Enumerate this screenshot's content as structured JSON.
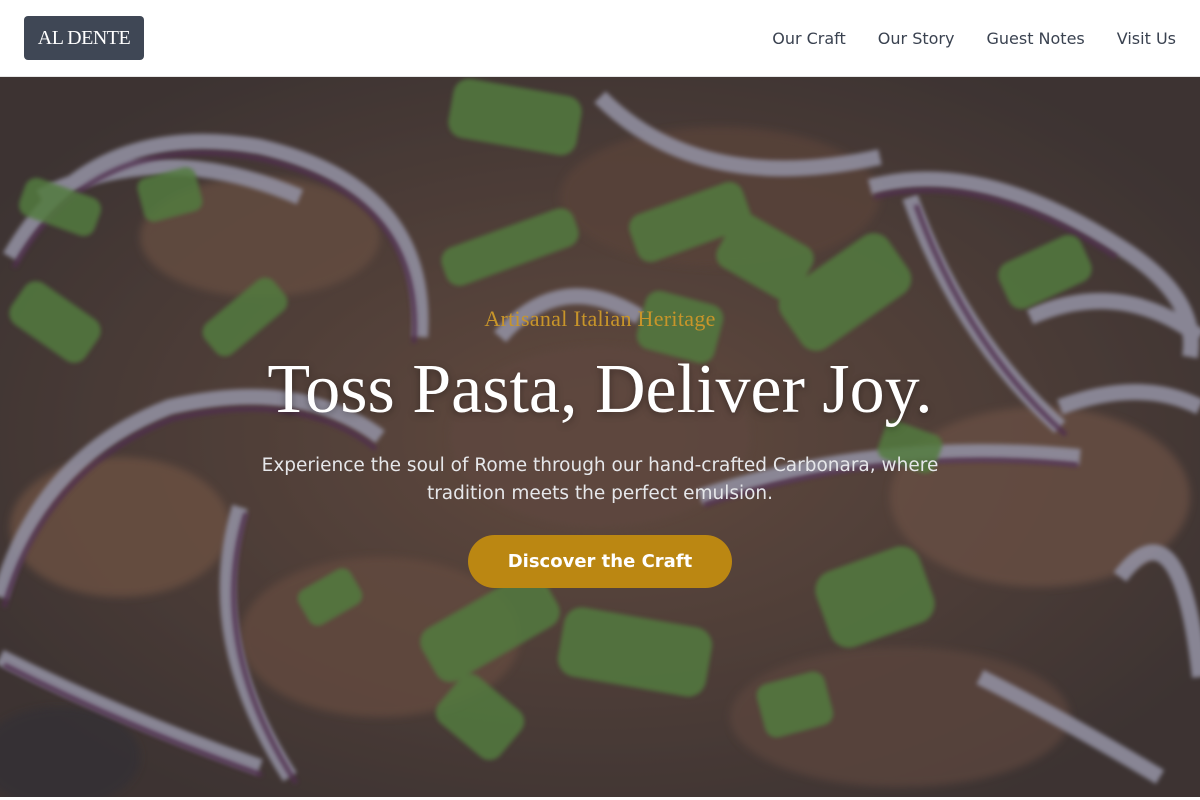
{
  "header": {
    "logo_text": "AL DENTE",
    "nav": [
      {
        "label": "Our Craft"
      },
      {
        "label": "Our Story"
      },
      {
        "label": "Guest Notes"
      },
      {
        "label": "Visit Us"
      }
    ]
  },
  "hero": {
    "eyebrow": "Artisanal Italian Heritage",
    "headline": "Toss Pasta, Deliver Joy.",
    "subhead": "Experience the soul of Rome through our hand-crafted Carbonara, where tradition meets the perfect emulsion.",
    "cta_label": "Discover the Craft"
  },
  "colors": {
    "accent": "#bb8712",
    "eyebrow": "#c8952a",
    "logo_bg": "#3f4755",
    "nav_text": "#3a4250"
  }
}
